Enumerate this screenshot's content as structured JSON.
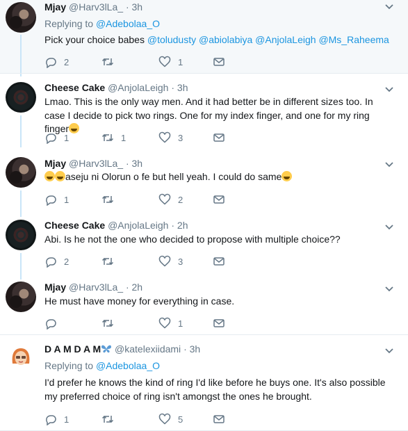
{
  "icons": {
    "reply": "reply-icon",
    "retweet": "retweet-icon",
    "like": "heart-icon",
    "dm": "envelope-icon",
    "more": "chevron-down-icon"
  },
  "colors": {
    "link": "#1b95e0",
    "muted": "#657786",
    "thread_line": "#c9e5f8",
    "highlight_bg": "#f5f8fa"
  },
  "tweets": [
    {
      "name": "Mjay",
      "handle": "@Harv3lLa_",
      "sep": "·",
      "time": "3h",
      "reply_prefix": "Replying to",
      "reply_to": "@Adebolaa_O",
      "text_prefix": "Pick your choice babes",
      "mentions": [
        "@toludusty",
        "@abiolabiya",
        "@AnjolaLeigh",
        "@Ms_Raheema"
      ],
      "replies": "2",
      "retweets": "",
      "likes": "1"
    },
    {
      "name": "Cheese Cake",
      "handle": "@AnjolaLeigh",
      "sep": "·",
      "time": "3h",
      "text": "Lmao. This is the only way men. And it had better be in different sizes too. In case I decide to pick two rings. One for my index finger, and one for my ring finger",
      "replies": "1",
      "retweets": "1",
      "likes": "3"
    },
    {
      "name": "Mjay",
      "handle": "@Harv3lLa_",
      "sep": "·",
      "time": "3h",
      "text": "aseju ni Olorun o fe but hell yeah. I could do same",
      "replies": "1",
      "retweets": "",
      "likes": "2"
    },
    {
      "name": "Cheese Cake",
      "handle": "@AnjolaLeigh",
      "sep": "·",
      "time": "2h",
      "text": "Abi. Is he not the one who decided to propose with multiple choice??",
      "replies": "2",
      "retweets": "",
      "likes": "3"
    },
    {
      "name": "Mjay",
      "handle": "@Harv3lLa_",
      "sep": "·",
      "time": "2h",
      "text": "He must have money for everything in case.",
      "replies": "",
      "retweets": "",
      "likes": "1"
    },
    {
      "name": "D A M D A M",
      "handle": "@katelexiidami",
      "sep": "·",
      "time": "3h",
      "reply_prefix": "Replying to",
      "reply_to": "@Adebolaa_O",
      "text": "I'd prefer he knows the kind of ring I'd like before he buys one. It's also possible my preferred choice of ring isn't amongst the ones he brought.",
      "replies": "1",
      "retweets": "",
      "likes": "5"
    }
  ]
}
